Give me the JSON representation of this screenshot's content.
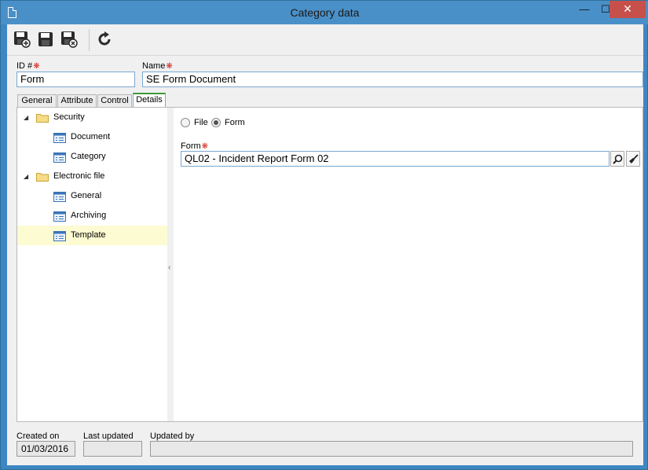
{
  "window": {
    "title": "Category data",
    "minimize_glyph": "—",
    "maximize_glyph": "☐",
    "close_glyph": "✕"
  },
  "toolbar": {
    "buttons": [
      "save-new-icon",
      "save-icon",
      "save-close-icon",
      "refresh-icon"
    ]
  },
  "fields": {
    "id_label": "ID #",
    "id_value": "Form",
    "name_label": "Name",
    "name_value": "SE Form Document",
    "required_mark": "❋"
  },
  "tabs": [
    {
      "label": "General"
    },
    {
      "label": "Attribute"
    },
    {
      "label": "Control"
    },
    {
      "label": "Details"
    }
  ],
  "tree": {
    "groups": [
      {
        "label": "Security",
        "items": [
          "Document",
          "Category"
        ]
      },
      {
        "label": "Electronic file",
        "items": [
          "General",
          "Archiving",
          "Template"
        ]
      }
    ],
    "expander_glyph": "◢",
    "selected": "Template"
  },
  "details": {
    "type_options": [
      {
        "label": "File",
        "checked": false
      },
      {
        "label": "Form",
        "checked": true
      }
    ],
    "form_label": "Form",
    "form_value": "QL02 - Incident Report Form 02"
  },
  "footer": {
    "created_on_label": "Created on",
    "created_on_value": "01/03/2016",
    "last_updated_label": "Last updated",
    "last_updated_value": "",
    "updated_by_label": "Updated by",
    "updated_by_value": ""
  },
  "colors": {
    "title_bar": "#4a90c8",
    "close_button": "#c7504b",
    "required": "#d2261b",
    "active_tab_accent": "#3c9a3c",
    "selection": "#fdfbd2"
  }
}
